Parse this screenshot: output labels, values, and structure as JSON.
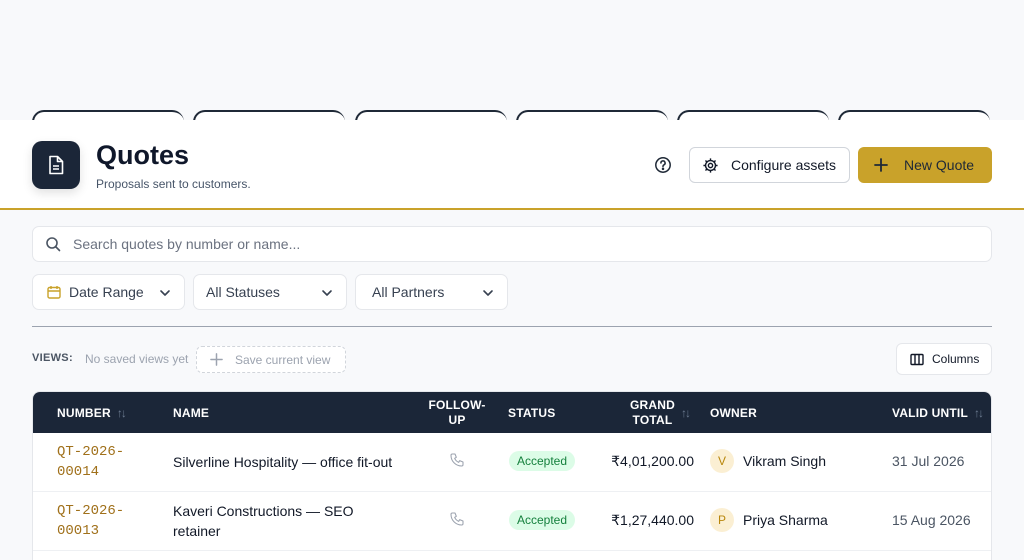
{
  "header": {
    "title": "Quotes",
    "subtitle": "Proposals sent to customers.",
    "configure_label": "Configure assets",
    "new_quote_label": "New Quote"
  },
  "search": {
    "placeholder": "Search quotes by number or name..."
  },
  "filters": {
    "date_range": "Date Range",
    "status": "All Statuses",
    "partners": "All Partners"
  },
  "views": {
    "label": "VIEWS:",
    "empty_text": "No saved views yet",
    "save_label": "Save current view",
    "columns_label": "Columns"
  },
  "table": {
    "headers": {
      "number": "NUMBER",
      "name": "NAME",
      "follow_up_1": "FOLLOW-",
      "follow_up_2": "UP",
      "status": "STATUS",
      "grand_total_1": "GRAND",
      "grand_total_2": "TOTAL",
      "owner": "OWNER",
      "valid_until": "VALID UNTIL"
    },
    "rows": [
      {
        "number_1": "QT-2026-",
        "number_2": "00014",
        "name_1": "Silverline Hospitality — office fit-out",
        "name_2": "",
        "status": "Accepted",
        "total": "₹4,01,200.00",
        "owner_initial": "V",
        "owner": "Vikram Singh",
        "valid_until": "31 Jul 2026"
      },
      {
        "number_1": "QT-2026-",
        "number_2": "00013",
        "name_1": "Kaveri Constructions — SEO",
        "name_2": "retainer",
        "status": "Accepted",
        "total": "₹1,27,440.00",
        "owner_initial": "P",
        "owner": "Priya Sharma",
        "valid_until": "15 Aug 2026"
      }
    ]
  },
  "colors": {
    "accent": "#c9a22a",
    "header_dark": "#1b2638",
    "accepted_bg": "#dcfce7",
    "accepted_text": "#15803d"
  },
  "icons": [
    "document-icon",
    "help-circle-icon",
    "gear-icon",
    "plus-icon",
    "search-icon",
    "calendar-icon",
    "chevron-down-icon",
    "sort-icon",
    "columns-icon",
    "phone-icon"
  ]
}
